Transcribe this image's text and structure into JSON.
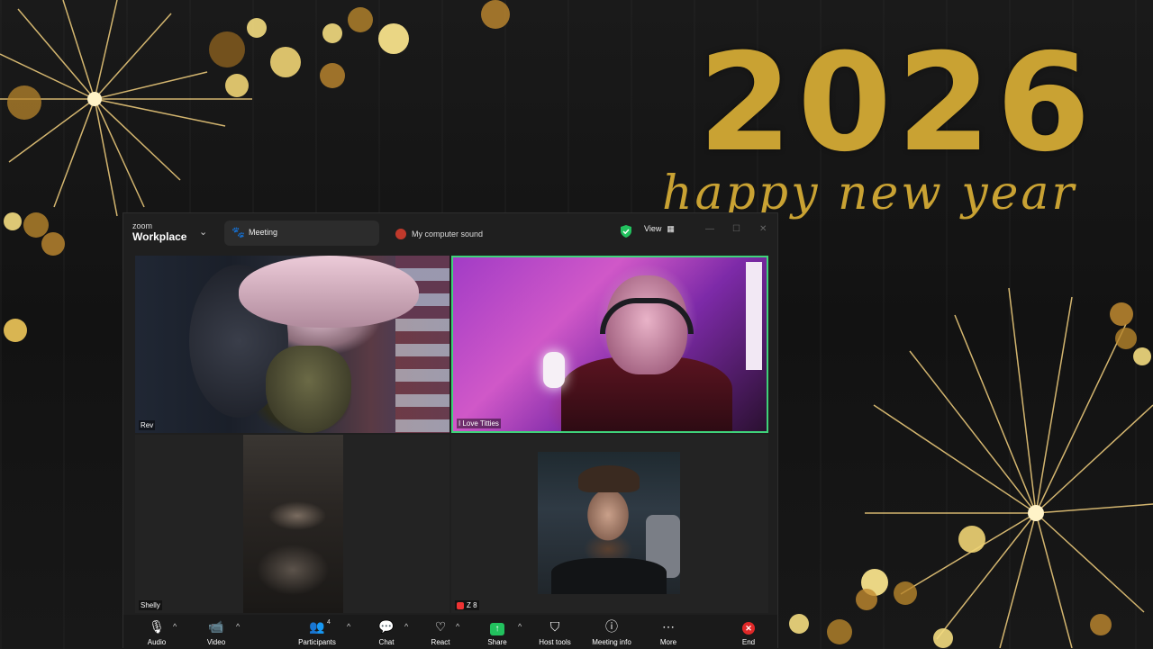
{
  "background": {
    "year": "2026",
    "greeting": "happy new year"
  },
  "titlebar": {
    "logo_top": "zoom",
    "logo_bottom": "Workplace",
    "meeting_tab": "Meeting",
    "shared_audio": "My computer sound",
    "view_label": "View"
  },
  "tiles": [
    {
      "name": "Rev"
    },
    {
      "name": "I Love Titties"
    },
    {
      "name": "Shelly"
    },
    {
      "name": "Z 8"
    }
  ],
  "toolbar": {
    "audio": "Audio",
    "video": "Video",
    "participants": "Participants",
    "participants_count": "4",
    "chat": "Chat",
    "react": "React",
    "share": "Share",
    "host_tools": "Host tools",
    "meeting_info": "Meeting info",
    "more": "More",
    "end": "End"
  },
  "colors": {
    "active_speaker_border": "#3fd27a",
    "share_green": "#22c15e",
    "end_red": "#e02828",
    "gold": "#c9a233"
  }
}
